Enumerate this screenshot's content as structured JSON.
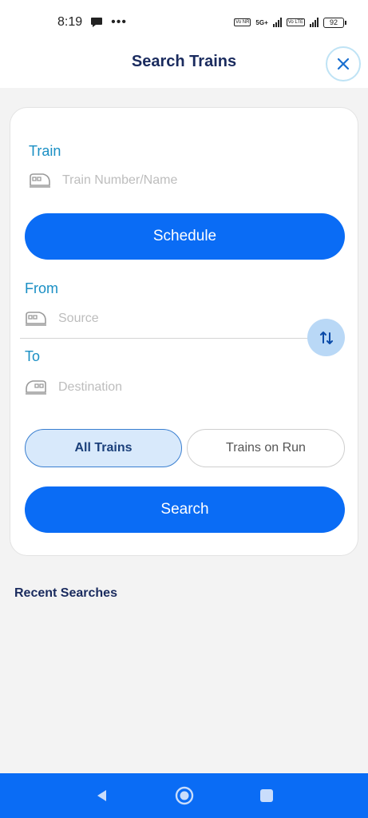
{
  "status_bar": {
    "time": "8:19",
    "network_label": "5G+",
    "volte1": "Vo NR",
    "volte2": "Vo LTE",
    "battery": "92"
  },
  "header": {
    "title": "Search Trains",
    "close_icon": "close-icon"
  },
  "form": {
    "train_label": "Train",
    "train_placeholder": "Train Number/Name",
    "schedule_button": "Schedule",
    "from_label": "From",
    "source_placeholder": "Source",
    "to_label": "To",
    "destination_placeholder": "Destination",
    "toggle_all": "All Trains",
    "toggle_run": "Trains on Run",
    "search_button": "Search"
  },
  "recent": {
    "title": "Recent Searches"
  },
  "colors": {
    "primary": "#0a6cf5",
    "title": "#1a2b5e",
    "label": "#1a8fc4"
  }
}
